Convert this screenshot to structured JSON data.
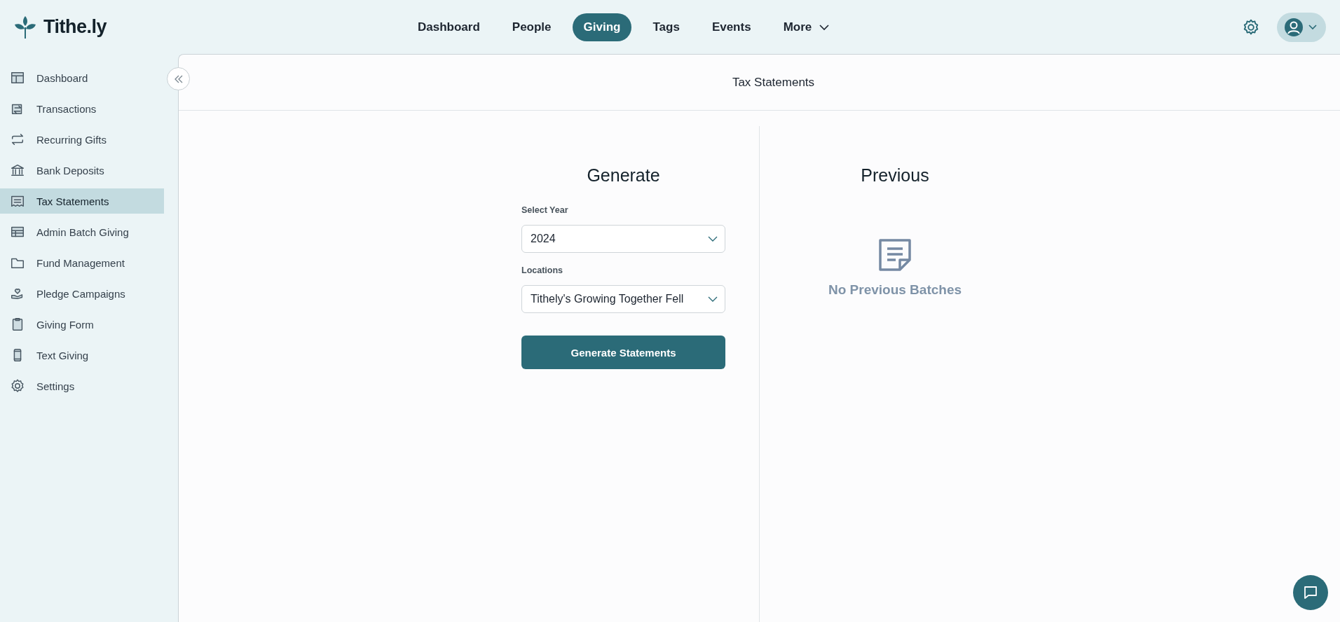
{
  "logo": {
    "text": "Tithe.ly"
  },
  "nav": [
    {
      "label": "Dashboard",
      "selected": false
    },
    {
      "label": "People",
      "selected": false
    },
    {
      "label": "Giving",
      "selected": true
    },
    {
      "label": "Tags",
      "selected": false
    },
    {
      "label": "Events",
      "selected": false
    },
    {
      "label": "More",
      "selected": false,
      "kind": "dropdown"
    }
  ],
  "sidebar": {
    "items": [
      {
        "label": "Dashboard",
        "selected": false
      },
      {
        "label": "Transactions",
        "selected": false
      },
      {
        "label": "Recurring Gifts",
        "selected": false
      },
      {
        "label": "Bank Deposits",
        "selected": false
      },
      {
        "label": "Tax Statements",
        "selected": true
      },
      {
        "label": "Admin Batch Giving",
        "selected": false
      },
      {
        "label": "Fund Management",
        "selected": false
      },
      {
        "label": "Pledge Campaigns",
        "selected": false
      },
      {
        "label": "Giving Form",
        "selected": false
      },
      {
        "label": "Text Giving",
        "selected": false
      },
      {
        "label": "Settings",
        "selected": false
      }
    ]
  },
  "page_title": "Tax Statements",
  "generate": {
    "heading": "Generate",
    "fields": [
      {
        "label": "Select Year",
        "value": "2024"
      },
      {
        "label": "Locations",
        "value": "Tithely's Growing Together Fell"
      }
    ],
    "button": "Generate Statements"
  },
  "previous": {
    "heading": "Previous",
    "empty_text": "No Previous Batches"
  }
}
